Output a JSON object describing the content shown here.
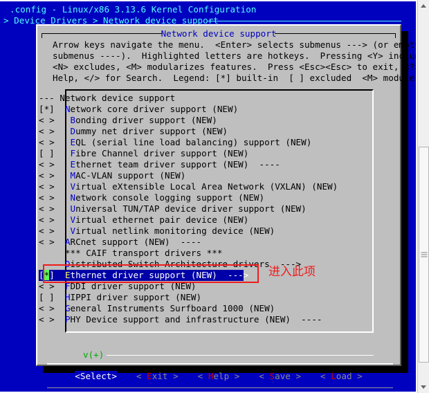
{
  "terminal": {
    "title": ".config - Linux/x86 3.13.6 Kernel Configuration",
    "breadcrumb": "> Device Drivers > Network device support"
  },
  "dialog": {
    "title": "Network device support",
    "help_lines": [
      "Arrow keys navigate the menu.  <Enter> selects submenus ---> (or empty",
      "submenus ----).  Highlighted letters are hotkeys.  Pressing <Y> includes,",
      "<N> excludes, <M> modularizes features.  Press <Esc><Esc> to exit, <?> for",
      "Help, </> for Search.  Legend: [*] built-in  [ ] excluded  <M> module  < >"
    ],
    "scroll_indicator": "v(+)"
  },
  "menu": {
    "items": [
      {
        "flag": "--- ",
        "indent": "",
        "hot": "",
        "text": "Network device support",
        "suffix": "",
        "selected": false,
        "cursor": false
      },
      {
        "flag": "[*] ",
        "indent": " ",
        "hot": "N",
        "text": "etwork core driver support (NEW)",
        "suffix": "",
        "selected": false,
        "cursor": false
      },
      {
        "flag": "< > ",
        "indent": "  ",
        "hot": "B",
        "text": "onding driver support (NEW)",
        "suffix": "",
        "selected": false,
        "cursor": false
      },
      {
        "flag": "< > ",
        "indent": "  ",
        "hot": "D",
        "text": "ummy net driver support (NEW)",
        "suffix": "",
        "selected": false,
        "cursor": false
      },
      {
        "flag": "< > ",
        "indent": "  ",
        "hot": "E",
        "text": "QL (serial line load balancing) support (NEW)",
        "suffix": "",
        "selected": false,
        "cursor": false
      },
      {
        "flag": "[ ] ",
        "indent": "  ",
        "hot": "F",
        "text": "ibre Channel driver support (NEW)",
        "suffix": "",
        "selected": false,
        "cursor": false
      },
      {
        "flag": "< > ",
        "indent": "  ",
        "hot": "E",
        "text": "thernet team driver support (NEW)",
        "suffix": "  ----",
        "selected": false,
        "cursor": false
      },
      {
        "flag": "< > ",
        "indent": "  ",
        "hot": "M",
        "text": "AC-VLAN support (NEW)",
        "suffix": "",
        "selected": false,
        "cursor": false
      },
      {
        "flag": "< > ",
        "indent": "  ",
        "hot": "V",
        "text": "irtual eXtensible Local Area Network (VXLAN) (NEW)",
        "suffix": "",
        "selected": false,
        "cursor": false
      },
      {
        "flag": "< > ",
        "indent": "  ",
        "hot": "N",
        "text": "etwork console logging support (NEW)",
        "suffix": "",
        "selected": false,
        "cursor": false
      },
      {
        "flag": "< > ",
        "indent": "  ",
        "hot": "U",
        "text": "niversal TUN/TAP device driver support (NEW)",
        "suffix": "",
        "selected": false,
        "cursor": false
      },
      {
        "flag": "< > ",
        "indent": "  ",
        "hot": "V",
        "text": "irtual ethernet pair device (NEW)",
        "suffix": "",
        "selected": false,
        "cursor": false
      },
      {
        "flag": "< > ",
        "indent": "  ",
        "hot": "V",
        "text": "irtual netlink monitoring device (NEW)",
        "suffix": "",
        "selected": false,
        "cursor": false
      },
      {
        "flag": "< > ",
        "indent": " ",
        "hot": "A",
        "text": "RCnet support (NEW)",
        "suffix": "  ----",
        "selected": false,
        "cursor": false
      },
      {
        "flag": "    ",
        "indent": " ",
        "hot": "",
        "text": "*** CAIF transport drivers ***",
        "suffix": "",
        "selected": false,
        "cursor": false
      },
      {
        "flag": "    ",
        "indent": " ",
        "hot": "D",
        "text": "istributed Switch Architecture drivers  --->",
        "suffix": "",
        "selected": false,
        "cursor": false
      },
      {
        "flag": "[*] ",
        "indent": " ",
        "hot": "E",
        "text": "thernet driver support (NEW)",
        "suffix": "  --->",
        "selected": true,
        "cursor": true
      },
      {
        "flag": "< > ",
        "indent": " ",
        "hot": "F",
        "text": "DDI driver support (NEW)",
        "suffix": "",
        "selected": false,
        "cursor": false
      },
      {
        "flag": "[ ] ",
        "indent": " ",
        "hot": "H",
        "text": "IPPI driver support (NEW)",
        "suffix": "",
        "selected": false,
        "cursor": false
      },
      {
        "flag": "< > ",
        "indent": " ",
        "hot": "G",
        "text": "eneral Instruments Surfboard 1000 (NEW)",
        "suffix": "",
        "selected": false,
        "cursor": false
      },
      {
        "flag": "< > ",
        "indent": " ",
        "hot": "P",
        "text": "HY Device support and infrastructure (NEW)",
        "suffix": "  ----",
        "selected": false,
        "cursor": false
      }
    ]
  },
  "buttons": [
    {
      "pre": "<",
      "hot": "S",
      "post": "elect>",
      "active": true
    },
    {
      "pre": "< ",
      "hot": "E",
      "post": "xit >",
      "active": false
    },
    {
      "pre": "< ",
      "hot": "H",
      "post": "elp >",
      "active": false
    },
    {
      "pre": "< ",
      "hot": "S",
      "post": "ave >",
      "active": false
    },
    {
      "pre": "< ",
      "hot": "L",
      "post": "oad >",
      "active": false
    }
  ],
  "annotation": {
    "text": "进入此项",
    "color": "#ee1c1c"
  },
  "colors": {
    "terminal_bg": "#0000bf",
    "dialog_bg": "#bfbfbf",
    "cyan": "#55ffff",
    "hotkey_blue": "#0000cf",
    "selected_bg": "#0000a8",
    "selected_hot": "#ffff55",
    "cursor_green": "#55ff55",
    "scroll_green": "#00aa00",
    "button_hot_red": "#cf0000"
  }
}
